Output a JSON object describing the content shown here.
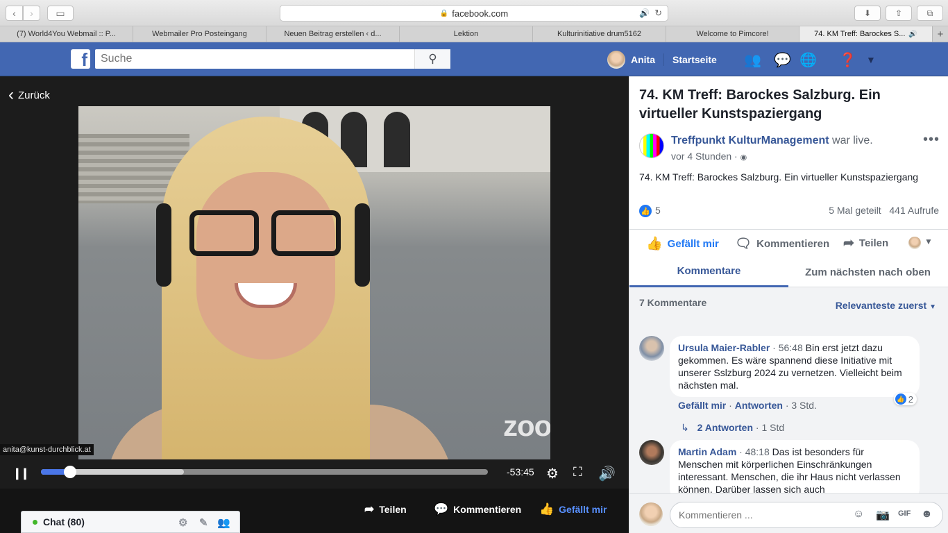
{
  "browser": {
    "url": "facebook.com",
    "tabs": [
      {
        "label": "(7) World4You Webmail :: P..."
      },
      {
        "label": "Webmailer Pro Posteingang"
      },
      {
        "label": "Neuen Beitrag erstellen ‹ d..."
      },
      {
        "label": "Lektion"
      },
      {
        "label": "Kulturinitiative drum5162"
      },
      {
        "label": "Welcome to Pimcore!"
      },
      {
        "label": "74. KM Treff: Barockes S..."
      }
    ]
  },
  "header": {
    "search_placeholder": "Suche",
    "user_name": "Anita",
    "home_label": "Startseite",
    "brand_color": "#4267b2"
  },
  "video": {
    "back_label": "Zurück",
    "email_overlay": "anita@kunst-durchblick.at",
    "watermark": "zoom",
    "time_remaining": "-53:45",
    "progress_played": 0.065,
    "progress_buffered": 0.32,
    "actions": {
      "share": "Teilen",
      "comment": "Kommentieren",
      "like": "Gefällt mir"
    }
  },
  "chat": {
    "label": "Chat (80)"
  },
  "post": {
    "title": "74. KM Treff: Barockes Salzburg. Ein virtueller Kunstspaziergang",
    "page_name": "Treffpunkt KulturManagement",
    "status": "war live.",
    "time": "vor 4 Stunden ·",
    "description": "74. KM Treff: Barockes Salzburg. Ein virtueller Kunstspaziergang",
    "likes": "5",
    "shares": "5 Mal geteilt",
    "views": "441 Aufrufe",
    "actions": {
      "like": "Gefällt mir",
      "comment": "Kommentieren",
      "share": "Teilen"
    }
  },
  "comments": {
    "tab_comments": "Kommentare",
    "tab_top": "Zum nächsten nach oben",
    "count": "7 Kommentare",
    "sort": "Relevanteste zuerst",
    "items": [
      {
        "author": "Ursula Maier-Rabler",
        "time": "· 56:48",
        "text": "Bin erst jetzt dazu gekommen. Es wäre spannend diese Initiative mit unserer Sslzburg 2024 zu vernetzen. Vielleicht beim nächsten mal.",
        "like_label": "Gefällt mir",
        "reply_label": "Antworten",
        "age": "· 3 Std.",
        "reactions": "2",
        "replies": "2 Antworten",
        "replies_age": "· 1 Std"
      },
      {
        "author": "Martin Adam",
        "time": "· 48:18",
        "text": "Das ist besonders für Menschen mit körperlichen Einschränkungen interessant. Menschen, die ihr Haus nicht verlassen können. Darüber lassen sich auch"
      }
    ],
    "compose_placeholder": "Kommentieren ..."
  }
}
